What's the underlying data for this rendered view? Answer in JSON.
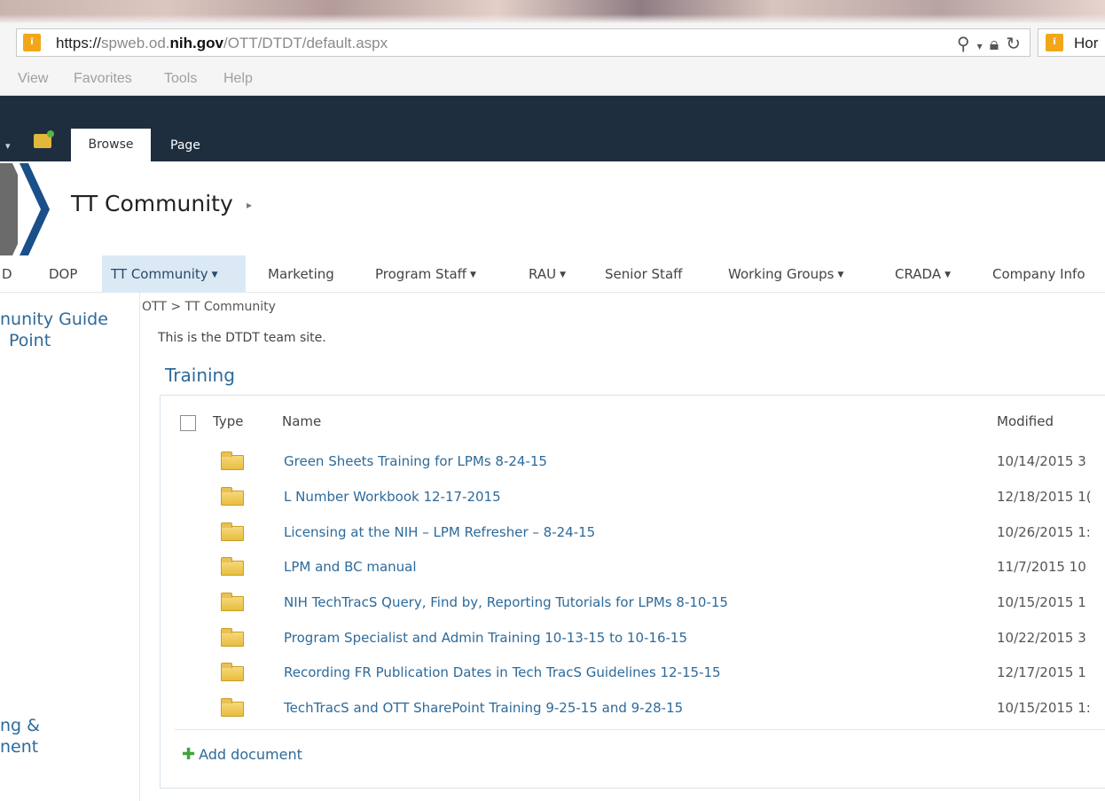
{
  "browser": {
    "url_prefix": "https://",
    "url_host_pre": "spweb.od.",
    "url_host_domain": "nih.gov",
    "url_path": "/OTT/DTDT/default.aspx",
    "tab_label": "Hor",
    "search_icon": "search-icon",
    "lock_icon": "lock-icon",
    "refresh_icon": "refresh-icon"
  },
  "menu": {
    "items": [
      "View",
      "Favorites",
      "Tools",
      "Help"
    ]
  },
  "ribbon": {
    "tabs": [
      "Browse",
      "Page"
    ]
  },
  "site": {
    "title": "TT Community"
  },
  "top_nav": {
    "items": [
      {
        "label": "D"
      },
      {
        "label": "DOP"
      },
      {
        "label": "TT Community"
      },
      {
        "label": "Marketing"
      },
      {
        "label": "Program Staff"
      },
      {
        "label": "RAU"
      },
      {
        "label": "Senior Staff"
      },
      {
        "label": "Working Groups"
      },
      {
        "label": "CRADA"
      },
      {
        "label": "Company Info"
      }
    ]
  },
  "left_nav": {
    "items": [
      {
        "line1": "nunity Guide",
        "line2": "Point"
      },
      {
        "line1": "ng &",
        "line2": "nent"
      }
    ]
  },
  "breadcrumb": {
    "parent": "OTT",
    "separator": ">",
    "current": "TT Community"
  },
  "description": "This is the DTDT team site.",
  "library": {
    "title": "Training",
    "columns": {
      "type": "Type",
      "name": "Name",
      "modified": "Modified"
    },
    "rows": [
      {
        "name": "Green Sheets Training for LPMs 8-24-15",
        "modified": "10/14/2015 3"
      },
      {
        "name": "L Number Workbook 12-17-2015",
        "modified": "12/18/2015 1("
      },
      {
        "name": "Licensing at the NIH – LPM Refresher – 8-24-15",
        "modified": "10/26/2015 1:"
      },
      {
        "name": "LPM and BC manual",
        "modified": "11/7/2015 10"
      },
      {
        "name": "NIH TechTracS Query, Find by, Reporting Tutorials for LPMs 8-10-15",
        "modified": "10/15/2015 1"
      },
      {
        "name": "Program Specialist and Admin Training 10-13-15 to 10-16-15",
        "modified": "10/22/2015 3"
      },
      {
        "name": "Recording FR Publication Dates in Tech TracS Guidelines 12-15-15",
        "modified": "12/17/2015 1"
      },
      {
        "name": "TechTracS and OTT SharePoint Training 9-25-15 and 9-28-15",
        "modified": "10/15/2015 1:"
      }
    ],
    "add_label": "Add document"
  }
}
